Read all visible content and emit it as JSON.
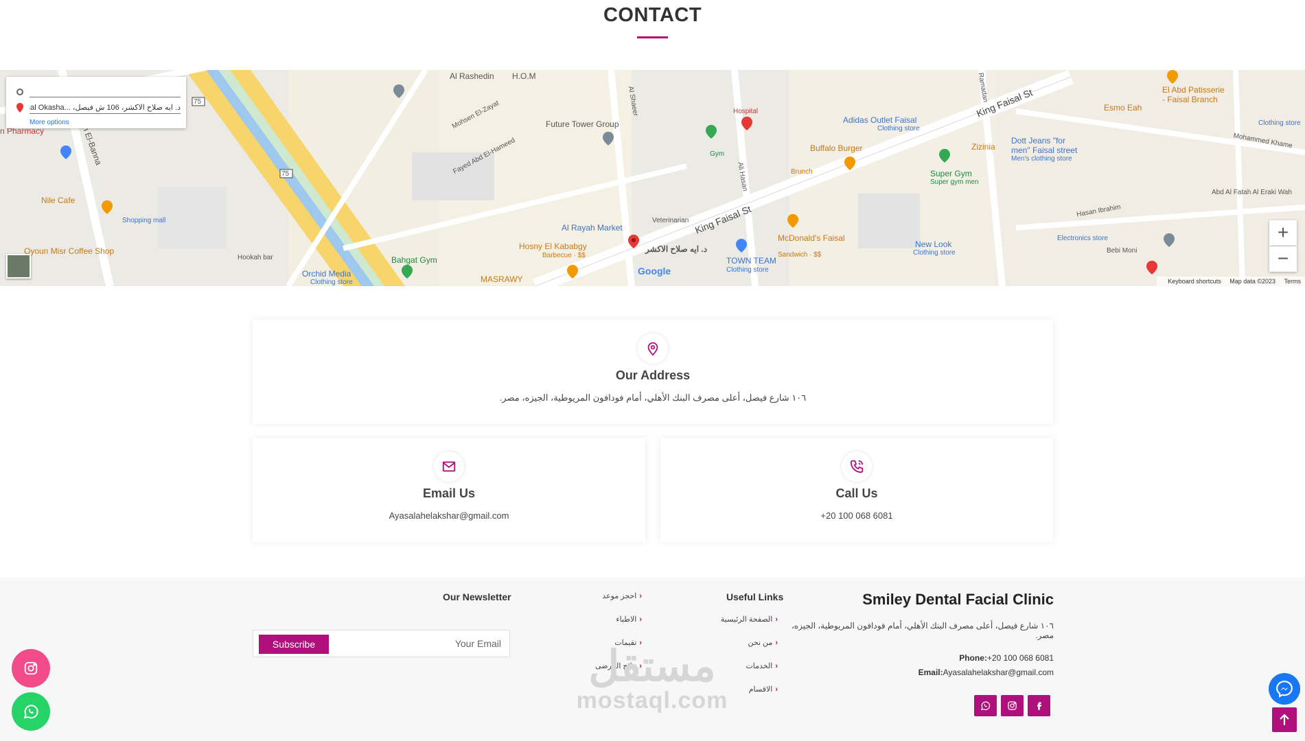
{
  "header": {
    "title": "CONTACT"
  },
  "map": {
    "card": {
      "destination": "د. ايه صلاح الاكشر، 106 ش فيصل، ...ysal Okasha",
      "more_options": "More options"
    },
    "labels": {
      "h_o_m": "H.O.M",
      "al_rashedin": "Al Rashedin",
      "future_tower": "Future Tower Group",
      "mohsen_el_zayat": "Mohsen El-Zayat",
      "fayed_abd_el_hameed": "Fayed Abd El-Hameed",
      "al_shaeer": "Al Shaeer",
      "al_hasan": "Ali Hasan",
      "king_faisal_1": "King Faisal St",
      "king_faisal_2": "King Faisal St",
      "al_rayah": "Al Rayah Market",
      "hosny": "Hosny El Kababgy",
      "hosny_sub": "Barbecue · $$",
      "bahgat": "Bahgat Gym",
      "masrawy": "MASRAWY",
      "mcdonalds": "McDonald's Faisal",
      "mcdonalds_sub": "Sandwich · $$",
      "town_team": "TOWN TEAM",
      "town_team_sub": "Clothing store",
      "buffalo": "Buffalo Burger",
      "adidas": "Adidas Outlet Faisal",
      "adidas_sub": "Clothing store",
      "super_gym": "Super Gym",
      "super_gym_sub": "Super gym men",
      "zizinia": "Zizinia",
      "dott": "Dott Jeans \"for",
      "dott2": "men\" Faisal street",
      "dott_sub": "Men's clothing store",
      "esmo": "Esmo Eah",
      "el_abd": "El Abd Patisserie",
      "el_abd2": "- Faisal Branch",
      "hasan_ibrahim": "Hasan Ibrahim",
      "bebi_moni": "Bebi Moni",
      "new_look": "New Look",
      "new_look_sub": "Clothing store",
      "nile_cafe": "Nile Cafe",
      "oyoun": "Oyoun Misr Coffee Shop",
      "pharmacy": "n Pharmacy",
      "el_banna": "en El-Banna",
      "orchid": "Orchid Media",
      "orchid_sub": "Clothing store",
      "ramadan": "Ramadan",
      "abd_al_fatah": "Abd Al Fatah Al Eraki Wah",
      "mohammed": "Mohammed Khame",
      "clinic": "د. ايه صلاح الاكشر",
      "brunch": "Brunch",
      "gym_ar": "Gym",
      "veterinarian": "Veterinarian",
      "hospital": "Hospital",
      "hookah_bar": "Hookah bar",
      "shopping_mall": "Shopping mall",
      "clothing_store": "Clothing store",
      "electronics": "Electronics store",
      "route_75a": "75",
      "route_75b": "75"
    },
    "zoom_in": "+",
    "zoom_out": "−",
    "google": "Google",
    "footer": {
      "shortcuts": "Keyboard shortcuts",
      "data": "Map data ©2023",
      "terms": "Terms"
    }
  },
  "cards": {
    "address": {
      "title": "Our Address",
      "text": "١٠٦ شارع فيصل، أعلى مصرف البنك الأهلي، أمام فودافون المريوطية، الجيزه، مصر."
    },
    "email": {
      "title": "Email Us",
      "text": "Ayasalahelakshar@gmail.com"
    },
    "call": {
      "title": "Call Us",
      "text": "+20 100 068 6081"
    }
  },
  "footer": {
    "brand": "Smiley Dental Facial Clinic",
    "address": "١٠٦ شارع فيصل، أعلى مصرف البنك الأهلي، أمام فودافون المريوطية، الجيزه، مصر.",
    "phone_label": "Phone:",
    "phone": "+20 100 068 6081",
    "email_label": "Email:",
    "email": "Ayasalahelakshar@gmail.com",
    "useful_links": {
      "heading": "Useful Links",
      "items": [
        "الصفحة الرئيسية",
        "من نحن",
        "الخدمات",
        "الاقسام"
      ]
    },
    "more_links": {
      "items": [
        "احجز موعد",
        "الاطباء",
        "تقيمات",
        "نتائج المرضى"
      ]
    },
    "newsletter": {
      "heading": "Our Newsletter",
      "subscribe": "Subscribe",
      "placeholder": "Your Email"
    },
    "watermark": {
      "ar": "مستقل",
      "en": "mostaql.com"
    }
  },
  "colors": {
    "accent": "#b0107c",
    "instagram": "#f24b8a",
    "whatsapp": "#25d366",
    "messenger": "#1877f2"
  }
}
